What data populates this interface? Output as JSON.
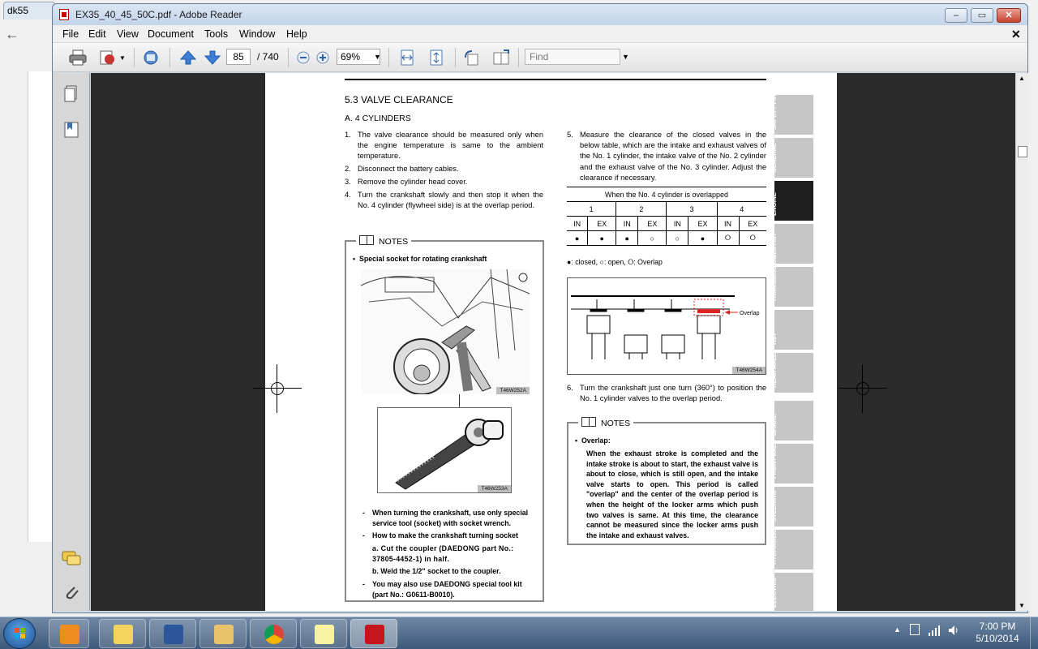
{
  "background_browser": {
    "tab_label": "dk55"
  },
  "window": {
    "title": "EX35_40_45_50C.pdf - Adobe Reader",
    "minimize": "–",
    "maximize": "▭",
    "close": "✕"
  },
  "menu": {
    "items": [
      "File",
      "Edit",
      "View",
      "Document",
      "Tools",
      "Window",
      "Help"
    ],
    "close_doc": "✕"
  },
  "toolbar": {
    "page_current": "85",
    "page_total": "/ 740",
    "zoom": "69%",
    "find_placeholder": "Find"
  },
  "doc": {
    "section_title": "5.3  VALVE CLEARANCE",
    "subsection_title": "A. 4 CYLINDERS",
    "left_steps": [
      {
        "num": "1.",
        "text": "The valve clearance should be measured only when the engine temperature is same to the ambient temperature."
      },
      {
        "num": "2.",
        "text": "Disconnect the battery cables."
      },
      {
        "num": "3.",
        "text": "Remove the cylinder head cover."
      },
      {
        "num": "4.",
        "text": "Turn the crankshaft slowly and then stop it when the No. 4 cylinder (flywheel side) is at the overlap period."
      }
    ],
    "notes_left": {
      "heading": "NOTES",
      "bullet": "Special socket for rotating crankshaft",
      "image1_tag": "T46W252A",
      "image2_tag": "T46W253A",
      "dash_items": [
        "When turning the crankshaft, use only special service tool (socket) with socket wrench.",
        "How to make the crankshaft turning socket",
        "You may also use DAEDONG special tool kit (part No.: G0611-B0010)."
      ],
      "sub_items": [
        "a. Cut the coupler (DAEDONG part No.: 37805-4452-1) in half.",
        "b. Weld the 1/2\" socket to the coupler."
      ]
    },
    "step5": {
      "num": "5.",
      "text": "Measure the clearance of the closed valves in the below table, which are the intake and exhaust valves of the No. 1 cylinder, the intake valve of the No. 2 cylinder and the exhaust valve of the No. 3 cylinder. Adjust the clearance if necessary."
    },
    "table": {
      "caption": "When the No. 4 cylinder is overlapped",
      "cylinders": [
        "1",
        "2",
        "3",
        "4"
      ],
      "valves": [
        "IN",
        "EX",
        "IN",
        "EX",
        "IN",
        "EX",
        "IN",
        "EX"
      ],
      "states": [
        "●",
        "●",
        "●",
        "○",
        "○",
        "●",
        "⭘",
        "⭘"
      ]
    },
    "legend": "●: closed, ○: open, ⭘: Overlap",
    "diagram_label": "Overlap",
    "diagram_tag": "T46W254A",
    "step6": {
      "num": "6.",
      "text": "Turn the crankshaft just one turn (360°) to position the No. 1 cylinder valves to the overlap period."
    },
    "notes_right": {
      "heading": "NOTES",
      "bullet": "Overlap:",
      "body": "When the exhaust stroke is completed and the intake stroke is about to start, the exhaust valve is about to close, which is still open, and the intake valve starts to open. This period is called \"overlap\" and the center of the overlap period is when the height of the locker arms which push two valves is same. At this time, the clearance cannot be measured since the locker arms push the intake and exhaust valves."
    },
    "side_tabs": [
      "SAFETY FIRST",
      "GENERAL",
      "ENGINE",
      "CLUTCH",
      "TRANSMISSION",
      "HST",
      "REAR AXLE",
      "BRAKE",
      "FRONT AXLE",
      "STEERING",
      "HYDRAULIC",
      "ELECTRIC"
    ],
    "active_tab": "ENGINE"
  },
  "taskbar": {
    "clock_time": "7:00 PM",
    "clock_date": "5/10/2014"
  }
}
